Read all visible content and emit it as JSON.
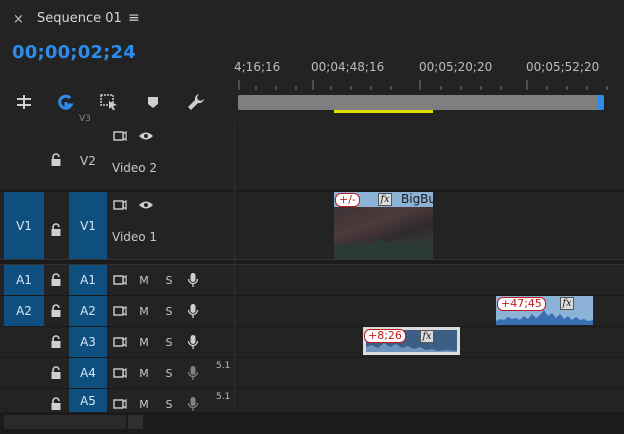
{
  "sequence": {
    "close_glyph": "×",
    "title": "Sequence 01",
    "menu_glyph": "≡",
    "timecode": "00;00;02;24"
  },
  "ruler": {
    "labels": [
      "4;16;16",
      "00;04;48;16",
      "00;05;20;20",
      "00;05;52;20"
    ]
  },
  "tools": [
    {
      "name": "snap-icon",
      "glyph": "⫩"
    },
    {
      "name": "linked-selection-icon",
      "glyph": "G"
    },
    {
      "name": "add-marker-panel-icon",
      "glyph": "⊡"
    },
    {
      "name": "marker-icon",
      "glyph": "⬟"
    },
    {
      "name": "wrench-icon",
      "glyph": "🔧"
    }
  ],
  "tracks": {
    "v3": {
      "label": "V3"
    },
    "v2": {
      "label": "V2",
      "name": "Video 2"
    },
    "v1": {
      "source": "V1",
      "label": "V1",
      "name": "Video 1"
    },
    "audio": [
      {
        "source": "A1",
        "label": "A1",
        "m": "M",
        "s": "S",
        "badge": ""
      },
      {
        "source": "A2",
        "label": "A2",
        "m": "M",
        "s": "S",
        "badge": ""
      },
      {
        "source": "",
        "label": "A3",
        "m": "M",
        "s": "S",
        "badge": ""
      },
      {
        "source": "",
        "label": "A4",
        "m": "M",
        "s": "S",
        "badge": "5.1"
      },
      {
        "source": "",
        "label": "A5",
        "m": "M",
        "s": "S",
        "badge": "5.1"
      }
    ]
  },
  "clips": {
    "video": {
      "offset_label": "+/-",
      "fx": "fx",
      "name": "BigBu"
    },
    "a2": {
      "offset_label": "+47;45",
      "fx": "fx"
    },
    "a3": {
      "offset_label": "+8;26",
      "fx": "fx"
    }
  },
  "colors": {
    "accent_blue": "#2d8ceb",
    "track_target_blue": "#0f4f80",
    "work_area_yellow": "#e3df00",
    "offset_red": "#c21a1a"
  }
}
